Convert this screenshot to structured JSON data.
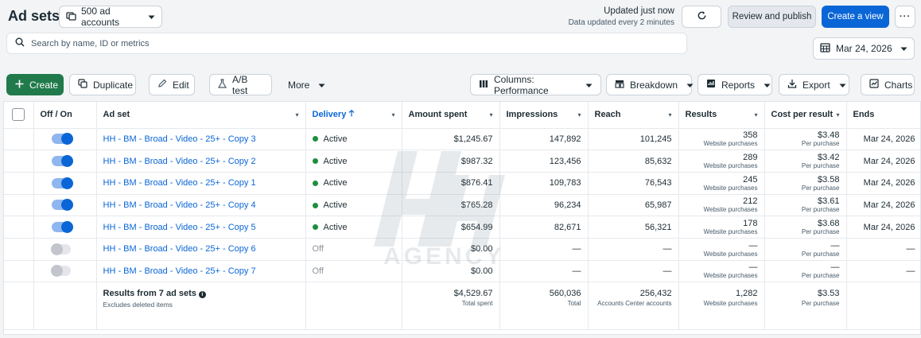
{
  "header": {
    "title": "Ad sets",
    "accounts_label": "500 ad accounts",
    "updated_line1": "Updated just now",
    "updated_line2": "Data updated every 2 minutes",
    "review_label": "Review and publish",
    "create_view_label": "Create a view",
    "more_dots": "···"
  },
  "search": {
    "placeholder": "Search by name, ID or metrics"
  },
  "date": {
    "label": "Mar 24, 2026"
  },
  "toolbar": {
    "create": "Create",
    "duplicate": "Duplicate",
    "edit": "Edit",
    "ab_test": "A/B test",
    "more": "More",
    "columns": "Columns: Performance",
    "breakdown": "Breakdown",
    "reports": "Reports",
    "export": "Export",
    "charts": "Charts"
  },
  "columns": {
    "offon": "Off / On",
    "adset": "Ad set",
    "delivery": "Delivery",
    "amount": "Amount spent",
    "impressions": "Impressions",
    "reach": "Reach",
    "results": "Results",
    "cpr": "Cost per result",
    "ends": "Ends"
  },
  "rows": [
    {
      "on": true,
      "name": "HH - BM - Broad - Video - 25+ - Copy 3",
      "delivery": "Active",
      "amount": "$1,245.67",
      "impressions": "147,892",
      "reach": "101,245",
      "results": "358",
      "results_sub": "Website purchases",
      "cpr": "$3.48",
      "cpr_sub": "Per purchase",
      "ends": "Mar 24, 2026"
    },
    {
      "on": true,
      "name": "HH - BM - Broad - Video - 25+ - Copy 2",
      "delivery": "Active",
      "amount": "$987.32",
      "impressions": "123,456",
      "reach": "85,632",
      "results": "289",
      "results_sub": "Website purchases",
      "cpr": "$3.42",
      "cpr_sub": "Per purchase",
      "ends": "Mar 24, 2026"
    },
    {
      "on": true,
      "name": "HH - BM - Broad - Video - 25+ - Copy 1",
      "delivery": "Active",
      "amount": "$876.41",
      "impressions": "109,783",
      "reach": "76,543",
      "results": "245",
      "results_sub": "Website purchases",
      "cpr": "$3.58",
      "cpr_sub": "Per purchase",
      "ends": "Mar 24, 2026"
    },
    {
      "on": true,
      "name": "HH - BM - Broad - Video - 25+ - Copy 4",
      "delivery": "Active",
      "amount": "$765.28",
      "impressions": "96,234",
      "reach": "65,987",
      "results": "212",
      "results_sub": "Website purchases",
      "cpr": "$3.61",
      "cpr_sub": "Per purchase",
      "ends": "Mar 24, 2026"
    },
    {
      "on": true,
      "name": "HH - BM - Broad - Video - 25+ - Copy 5",
      "delivery": "Active",
      "amount": "$654.99",
      "impressions": "82,671",
      "reach": "56,321",
      "results": "178",
      "results_sub": "Website purchases",
      "cpr": "$3.68",
      "cpr_sub": "Per purchase",
      "ends": "Mar 24, 2026"
    },
    {
      "on": false,
      "name": "HH - BM - Broad - Video - 25+ - Copy 6",
      "delivery": "Off",
      "amount": "$0.00",
      "impressions": "—",
      "reach": "—",
      "results": "—",
      "results_sub": "Website purchases",
      "cpr": "—",
      "cpr_sub": "Per purchase",
      "ends": "—"
    },
    {
      "on": false,
      "name": "HH - BM - Broad - Video - 25+ - Copy 7",
      "delivery": "Off",
      "amount": "$0.00",
      "impressions": "—",
      "reach": "—",
      "results": "—",
      "results_sub": "Website purchases",
      "cpr": "—",
      "cpr_sub": "Per purchase",
      "ends": "—"
    }
  ],
  "summary": {
    "title": "Results from 7 ad sets",
    "subtitle": "Excludes deleted items",
    "amount": "$4,529.67",
    "amount_sub": "Total spent",
    "impressions": "560,036",
    "impressions_sub": "Total",
    "reach": "256,432",
    "reach_sub": "Accounts Center accounts",
    "results": "1,282",
    "results_sub": "Website purchases",
    "cpr": "$3.53",
    "cpr_sub": "Per purchase"
  },
  "watermark": {
    "text": "AGENCY",
    "monogram": "HH"
  },
  "colors": {
    "primary": "#0a66d6",
    "create_green": "#217a4b",
    "active_dot": "#1e8e3e"
  },
  "icons": [
    "accounts-icon",
    "refresh-icon",
    "search-icon",
    "calendar-icon",
    "plus-icon",
    "duplicate-icon",
    "pencil-icon",
    "flask-icon",
    "columns-icon",
    "breakdown-icon",
    "reports-icon",
    "export-icon",
    "charts-icon",
    "sort-up-icon"
  ]
}
